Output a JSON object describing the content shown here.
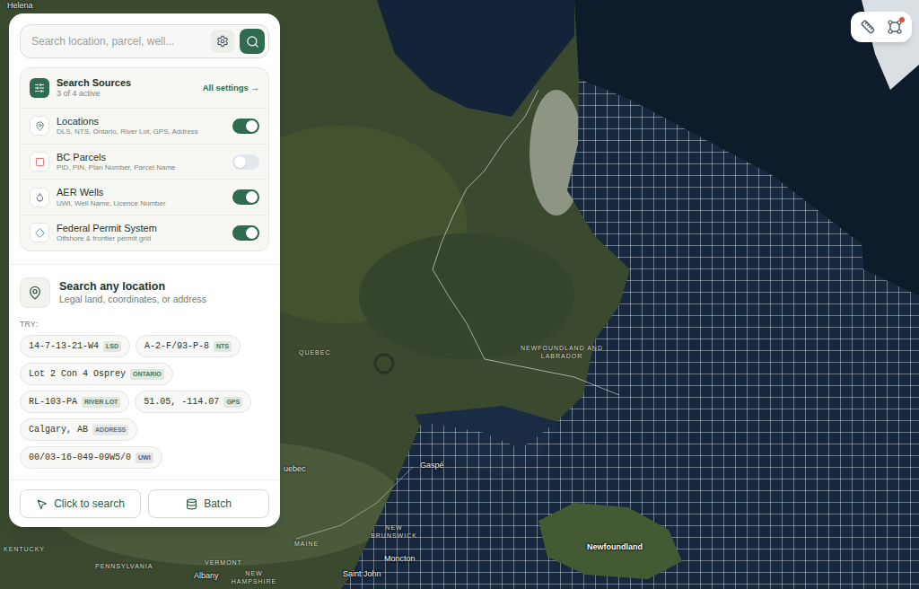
{
  "search": {
    "placeholder": "Search location, parcel, well..."
  },
  "sources": {
    "title": "Search Sources",
    "summary": "3 of 4 active",
    "settings_link": "All settings →",
    "items": [
      {
        "name": "Locations",
        "description": "DLS, NTS, Ontario, River Lot, GPS, Address",
        "on": true,
        "color": "#5f7a6a"
      },
      {
        "name": "BC Parcels",
        "description": "PID, PIN, Plan Number, Parcel Name",
        "on": false,
        "color": "#e0605a"
      },
      {
        "name": "AER Wells",
        "description": "UWI, Well Name, Licence Number",
        "on": true,
        "color": "#52607e"
      },
      {
        "name": "Federal Permit System",
        "description": "Offshore & frontier permit grid",
        "on": true,
        "color": "#5a8a94"
      }
    ]
  },
  "prompt": {
    "title": "Search any location",
    "subtitle": "Legal land, coordinates, or address",
    "try_label": "TRY:"
  },
  "examples": [
    {
      "text": "14-7-13-21-W4",
      "badge": "LSD",
      "color": "#3d7a55"
    },
    {
      "text": "A-2-F/93-P-8",
      "badge": "NTS",
      "color": "#3d7a55"
    },
    {
      "text": "Lot 2 Con 4 Osprey",
      "badge": "ONTARIO",
      "color": "#3d7a55"
    },
    {
      "text": "RL-103-PA",
      "badge": "RIVER LOT",
      "color": "#3d7a55"
    },
    {
      "text": "51.05, -114.07",
      "badge": "GPS",
      "color": "#3d7a55"
    },
    {
      "text": "Calgary, AB",
      "badge": "ADDRESS",
      "color": "#6b7280"
    },
    {
      "text": "00/03-16-049-09W5/0",
      "badge": "UWI",
      "color": "#4a5c8a"
    }
  ],
  "actions": [
    "Click to search",
    "Batch"
  ],
  "toolbar": {
    "alert": true
  },
  "map": {
    "labels": [
      {
        "text": "Helena",
        "kind": "city"
      },
      {
        "text": "QUEBEC",
        "kind": "region"
      },
      {
        "text": "NEWFOUNDLAND AND LABRADOR",
        "kind": "region"
      },
      {
        "text": "Gaspé",
        "kind": "city"
      },
      {
        "text": "uebec",
        "kind": "city"
      },
      {
        "text": "NEW BRUNSWICK",
        "kind": "region"
      },
      {
        "text": "MAINE",
        "kind": "region"
      },
      {
        "text": "Moncton",
        "kind": "city"
      },
      {
        "text": "Newfoundland",
        "kind": "island"
      },
      {
        "text": "VERMONT",
        "kind": "region"
      },
      {
        "text": "NEW HAMPSHIRE",
        "kind": "region"
      },
      {
        "text": "Albany",
        "kind": "city"
      },
      {
        "text": "Saint John",
        "kind": "city"
      },
      {
        "text": "KENTUCKY",
        "kind": "region"
      },
      {
        "text": "PENNSYLVANIA",
        "kind": "region"
      }
    ]
  }
}
